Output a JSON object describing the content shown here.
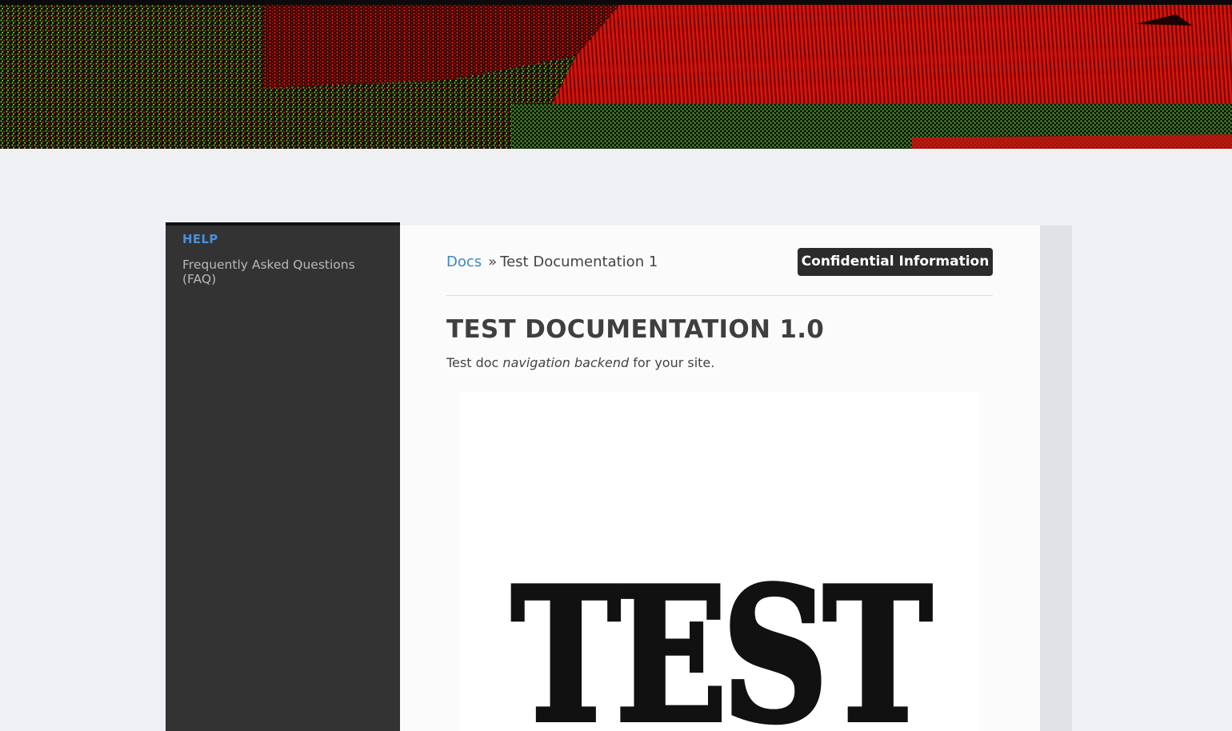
{
  "banner": {
    "colors": {
      "red": "#c8100c",
      "green": "#3fb431",
      "dark": "#150503"
    }
  },
  "sidebar": {
    "heading": "HELP",
    "items": [
      {
        "label": "Frequently Asked Questions (FAQ)"
      }
    ]
  },
  "breadcrumb": {
    "root": "Docs",
    "separator": "»",
    "current": "Test Documentation 1"
  },
  "badge": {
    "label": "Confidential Information"
  },
  "article": {
    "title": "TEST DOCUMENTATION 1.0",
    "intro_start": "Test doc ",
    "intro_emphasis": "navigation backend",
    "intro_end": " for your site.",
    "image_text": "TEST"
  },
  "colors": {
    "link": "#3f86c7",
    "sidebar_heading": "#4a8fd6",
    "sidebar_bg": "#333334",
    "badge_bg": "#2b2b2b",
    "page_bg": "#eef0f4"
  }
}
